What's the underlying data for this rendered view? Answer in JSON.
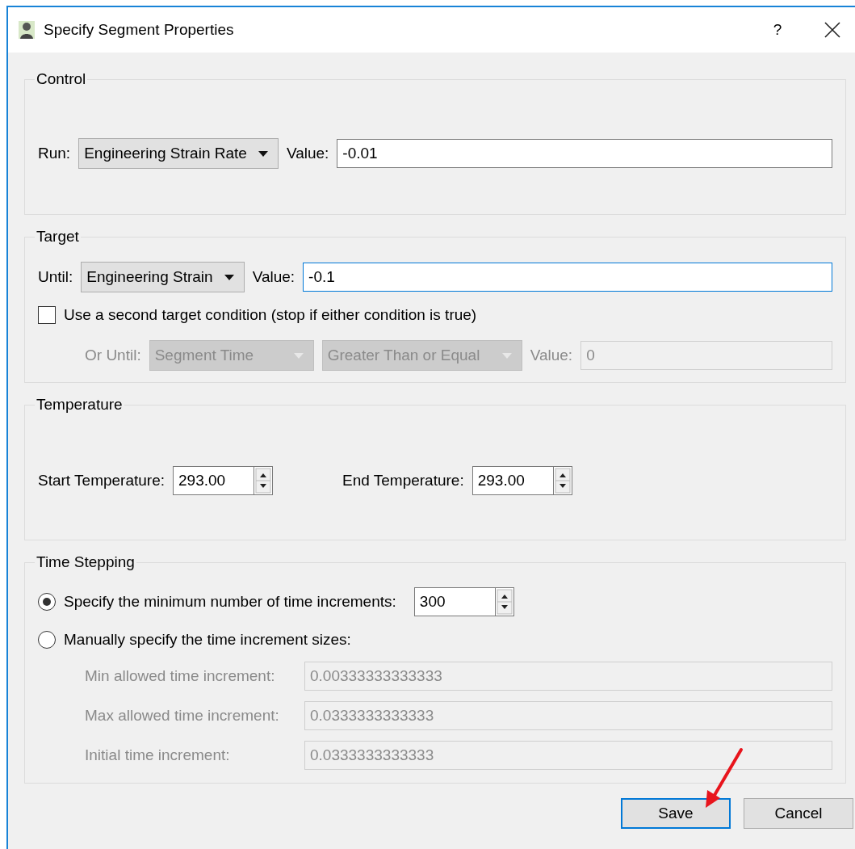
{
  "window": {
    "title": "Specify Segment Properties",
    "help": "?"
  },
  "control": {
    "title": "Control",
    "run_label": "Run:",
    "run_value": "Engineering Strain Rate",
    "value_label": "Value:",
    "value": "-0.01"
  },
  "target": {
    "title": "Target",
    "until_label": "Until:",
    "until_value": "Engineering Strain",
    "value_label": "Value:",
    "value": "-0.1",
    "focused": true,
    "second": {
      "label": "Use a second target condition (stop if either condition is true)",
      "checked": false
    },
    "or_until_label": "Or Until:",
    "or_until_value": "Segment Time",
    "comparison": "Greater Than or Equal",
    "or_value_label": "Value:",
    "or_value": "0",
    "disabled": true
  },
  "temperature": {
    "title": "Temperature",
    "start_label": "Start Temperature:",
    "start_value": "293.00",
    "end_label": "End Temperature:",
    "end_value": "293.00"
  },
  "time_stepping": {
    "title": "Time Stepping",
    "options": [
      {
        "label": "Specify the minimum number of time increments:",
        "selected": true
      },
      {
        "label": "Manually specify the time increment sizes:",
        "selected": false
      }
    ],
    "count": "300",
    "fields_disabled": true,
    "fields": [
      {
        "label": "Min allowed time increment:",
        "value": "0.00333333333333"
      },
      {
        "label": "Max allowed time increment:",
        "value": "0.0333333333333"
      },
      {
        "label": "Initial time increment:",
        "value": "0.0333333333333"
      }
    ]
  },
  "buttons": [
    {
      "label": "Save",
      "default": true
    },
    {
      "label": "Cancel",
      "default": false
    }
  ]
}
